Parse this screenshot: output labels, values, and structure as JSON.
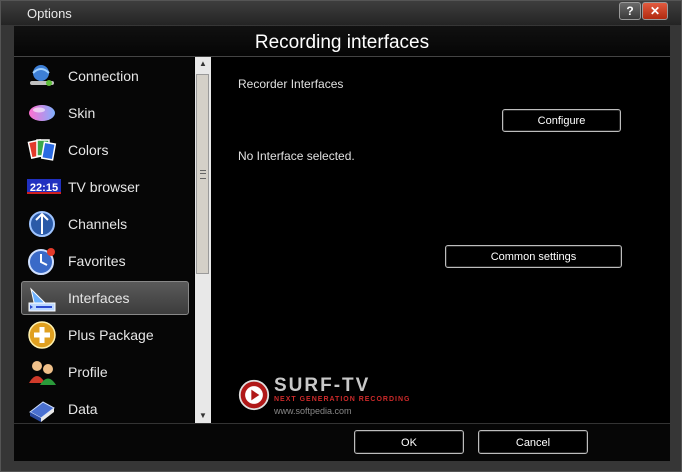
{
  "window": {
    "title": "Options",
    "help_label": "?",
    "close_label": "✕"
  },
  "header": {
    "title": "Recording interfaces"
  },
  "sidebar": {
    "items": [
      {
        "label": "Connection",
        "icon": "connection-icon"
      },
      {
        "label": "Skin",
        "icon": "skin-icon"
      },
      {
        "label": "Colors",
        "icon": "colors-icon"
      },
      {
        "label": "TV browser",
        "icon": "tv-browser-icon",
        "icon_text": "22:15"
      },
      {
        "label": "Channels",
        "icon": "channels-icon"
      },
      {
        "label": "Favorites",
        "icon": "favorites-icon"
      },
      {
        "label": "Interfaces",
        "icon": "interfaces-icon",
        "selected": true
      },
      {
        "label": "Plus Package",
        "icon": "plus-package-icon"
      },
      {
        "label": "Profile",
        "icon": "profile-icon"
      },
      {
        "label": "Data",
        "icon": "data-icon"
      }
    ]
  },
  "main": {
    "section_title": "Recorder Interfaces",
    "configure_label": "Configure",
    "status_text": "No Interface selected.",
    "common_settings_label": "Common settings"
  },
  "logo": {
    "name": "SURF-TV",
    "tagline": "NEXT GENERATION RECORDING",
    "url": "www.softpedia.com"
  },
  "footer": {
    "ok_label": "OK",
    "cancel_label": "Cancel"
  }
}
